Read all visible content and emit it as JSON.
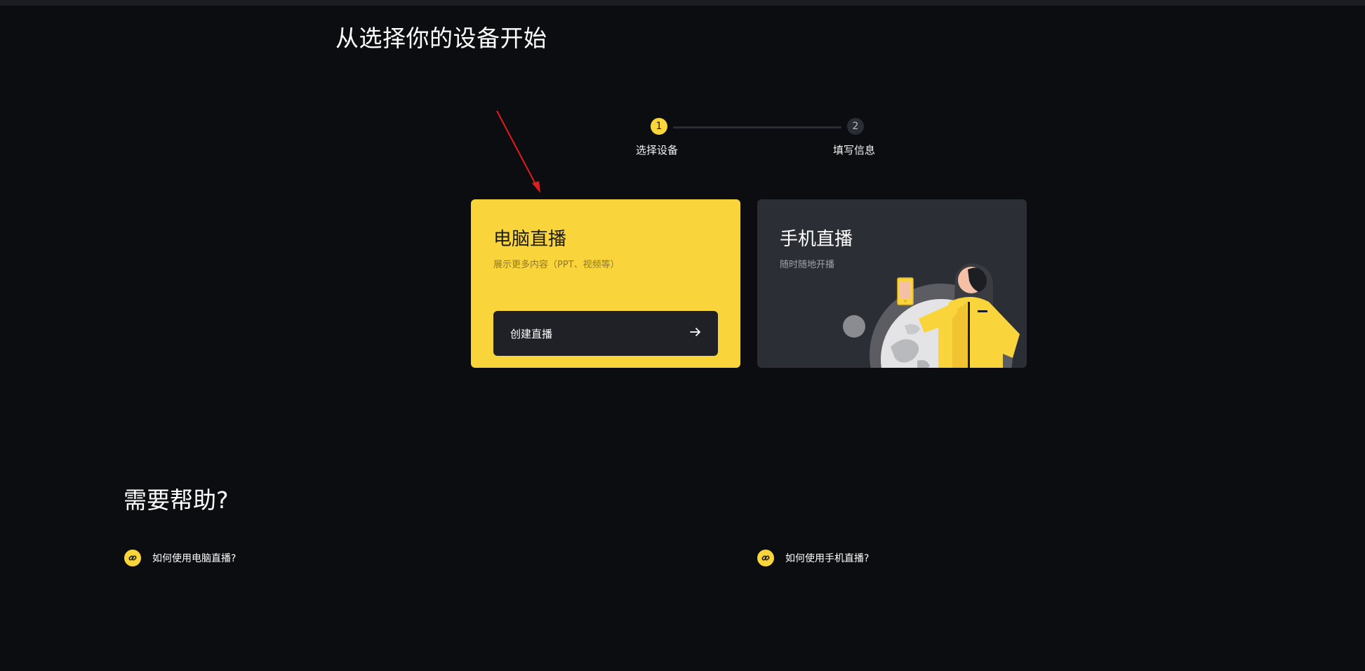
{
  "page": {
    "title": "从选择你的设备开始"
  },
  "stepper": {
    "steps": [
      {
        "number": "1",
        "label": "选择设备",
        "active": true
      },
      {
        "number": "2",
        "label": "填写信息",
        "active": false
      }
    ]
  },
  "cards": {
    "pc": {
      "title": "电脑直播",
      "description": "展示更多内容（PPT、视频等）",
      "button_label": "创建直播"
    },
    "mobile": {
      "title": "手机直播",
      "description": "随时随地开播"
    }
  },
  "help": {
    "title": "需要帮助?",
    "links": [
      {
        "label": "如何使用电脑直播?"
      },
      {
        "label": "如何使用手机直播?"
      }
    ]
  },
  "colors": {
    "accent": "#f9d43a",
    "background": "#0b0d10",
    "card_dark": "#2b2e35",
    "annotation": "#e11d1d"
  },
  "icons": {
    "button_icon": "arrow-right-icon",
    "help_link_icon": "link-icon"
  }
}
